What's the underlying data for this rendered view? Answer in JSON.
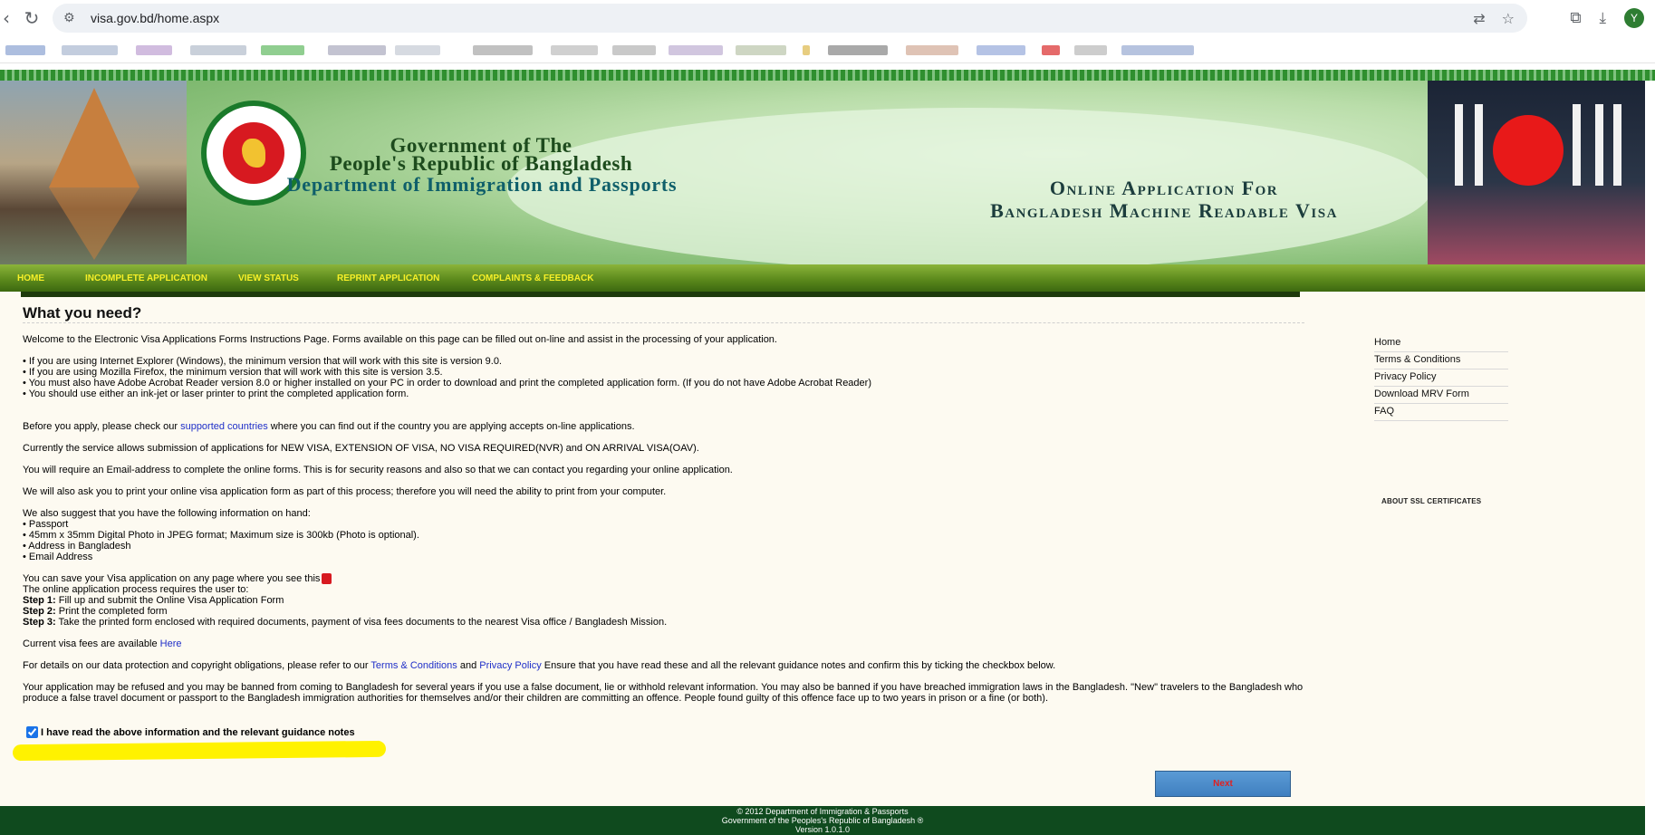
{
  "browser": {
    "url": "visa.gov.bd/home.aspx",
    "avatar_letter": "Y",
    "icons": [
      "back-icon",
      "reload-icon",
      "site-info-icon",
      "translate-icon",
      "star-icon",
      "extensions-icon",
      "download-icon"
    ]
  },
  "banner": {
    "gov_line1": "Government of The",
    "gov_line2": "People's Republic of Bangladesh",
    "dept": "Department of Immigration and Passports",
    "online_line1": "Online  Application For",
    "online_line2": "Bangladesh Machine Readable Visa"
  },
  "menu": {
    "items": [
      "HOME",
      "INCOMPLETE APPLICATION",
      "VIEW STATUS",
      "REPRINT APPLICATION",
      "COMPLAINTS & FEEDBACK"
    ]
  },
  "main": {
    "title": "What you need?",
    "welcome": "Welcome to the Electronic Visa Applications Forms Instructions Page. Forms available on this page can be filled out on-line and assist in the processing of your application.",
    "req1": "• If you are using Internet Explorer (Windows), the minimum version that will work with this site is version 9.0.",
    "req2": "• If you are using Mozilla Firefox, the minimum version that will work with this site is version 3.5.",
    "req3": "• You must also have Adobe Acrobat Reader version 8.0 or higher installed on your PC in order to download and print the completed application form. (If you do not have Adobe Acrobat Reader)",
    "req4": "• You should use either an ink-jet or laser printer to print the completed application form.",
    "before_pre": "Before you apply, please check our ",
    "before_link": "supported countries",
    "before_post": " where you can find out if the country you are applying accepts on-line applications.",
    "service": "Currently the service allows submission of applications for NEW VISA, EXTENSION OF VISA, NO VISA REQUIRED(NVR) and ON ARRIVAL VISA(OAV).",
    "email": "You will require an Email-address to complete the online forms. This is for security reasons and also so that we can contact you regarding your online application.",
    "print": "We will also ask you to print your online visa application form as part of this process; therefore you will need the ability to print from your computer.",
    "suggest": "We also suggest that you have the following information on hand:",
    "info1": "• Passport",
    "info2": "• 45mm x 35mm Digital Photo in JPEG format; Maximum size is 300kb (Photo is optional).",
    "info3": "• Address in Bangladesh",
    "info4": "• Email Address",
    "save_text": "You can save your Visa application on any page where you see this",
    "process": "The online application process requires the user to:",
    "step1_label": "Step 1:",
    "step1_text": " Fill up and submit the Online Visa Application Form",
    "step2_label": "Step 2:",
    "step2_text": " Print the completed form",
    "step3_label": "Step 3:",
    "step3_text": " Take the printed form enclosed with required documents, payment of visa fees documents to the nearest Visa office / Bangladesh Mission.",
    "fees_pre": "Current visa fees are available ",
    "fees_link": "Here",
    "details_pre": "For details on our data protection and copyright obligations, please refer to our ",
    "terms_link": "Terms & Conditions",
    "details_and": " and ",
    "privacy_link": "Privacy Policy",
    "details_post": " Ensure that you have read these and all the relevant guidance notes and confirm this by ticking the checkbox below.",
    "warning": "Your application may be refused and you may be banned from coming to Bangladesh for several years if you use a false document, lie or withhold relevant information. You may also be banned if you have breached immigration laws in the Bangladesh. \"New\" travelers to the Bangladesh who produce a false travel document or passport to the Bangladesh immigration authorities for themselves and/or their children are committing an offence. People found guilty of this offence face up to two years in prison or a fine (or both).",
    "checkbox_label": "I have read the above information and the relevant guidance notes",
    "checkbox_checked": true,
    "next_label": "Next"
  },
  "sidebar": {
    "links": [
      "Home",
      "Terms & Conditions",
      "Privacy Policy",
      "Download MRV Form",
      "FAQ"
    ],
    "ssl_label": "ABOUT SSL CERTIFICATES"
  },
  "footer": {
    "line1": "© 2012 Department of Immigration & Passports",
    "line2": "Government of the Peoples's Republic of Bangladesh ®",
    "line3": "Version 1.0.1.0"
  }
}
